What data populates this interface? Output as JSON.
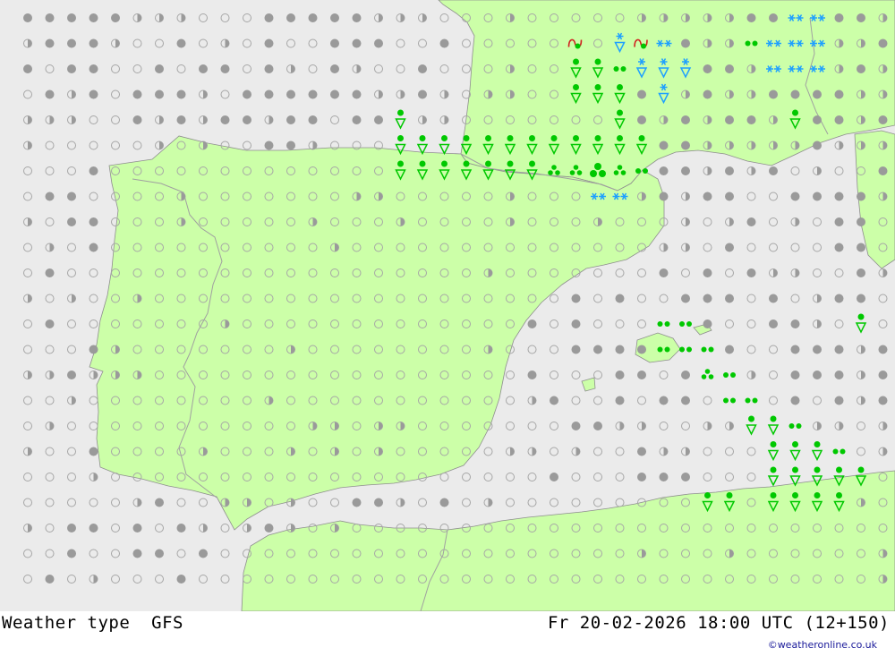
{
  "footer": {
    "left_label": "Weather type  GFS",
    "right_label": "Fr 20-02-2026 18:00 UTC (12+150)",
    "credit": "©weatheronline.co.uk"
  },
  "colors": {
    "sea": "#ebebeb",
    "land": "#ccffa8",
    "border": "#a0a0a0",
    "coast": "#8e8e8e",
    "clear_ring": "#a6a6a6",
    "cloud_fill": "#9a9a9a",
    "rain": "#00c800",
    "snow": "#1ea0ff",
    "mix": "#d12020"
  },
  "symbol_legend": {
    "clear": "clear-sky-icon",
    "partly": "partly-cloudy-icon",
    "overcast": "overcast-icon",
    "drizzle": "drizzle-icon",
    "rain": "rain-icon",
    "shower": "rain-shower-icon",
    "heavy": "heavy-rain-icon",
    "snow": "snow-icon",
    "snowshower": "snow-shower-icon",
    "mix": "rain-snow-mix-icon"
  }
}
